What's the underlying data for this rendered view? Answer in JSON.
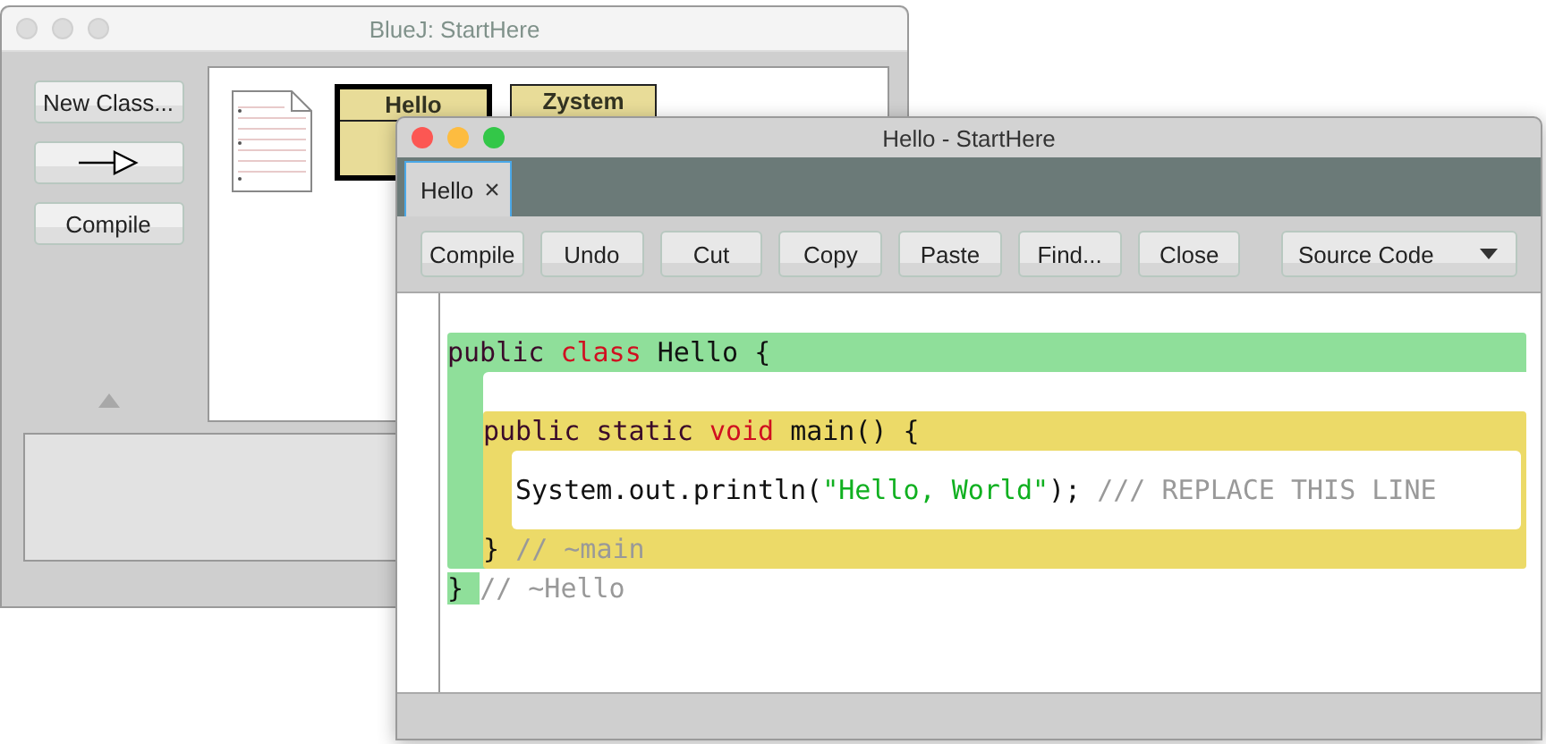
{
  "back_window": {
    "title": "BlueJ:  StartHere",
    "buttons": [
      {
        "label": "New Class...",
        "kind": "text"
      },
      {
        "kind": "arrow"
      },
      {
        "label": "Compile",
        "kind": "text"
      }
    ],
    "classes": [
      {
        "name": "Hello",
        "selected": true
      },
      {
        "name": "Zystem",
        "selected": false
      }
    ]
  },
  "front_window": {
    "title": "Hello - StartHere",
    "tabs": [
      {
        "label": "Hello",
        "close": "×",
        "selected": true
      }
    ],
    "toolbar": [
      "Compile",
      "Undo",
      "Cut",
      "Copy",
      "Paste",
      "Find...",
      "Close"
    ],
    "view_selector": "Source Code",
    "code": {
      "class_header": [
        {
          "text": "public ",
          "kind": "modifier"
        },
        {
          "text": "class ",
          "kind": "keyword"
        },
        {
          "text": "Hello {",
          "kind": "plain"
        }
      ],
      "method_header": [
        {
          "text": "public static ",
          "kind": "modifier"
        },
        {
          "text": "void ",
          "kind": "keyword"
        },
        {
          "text": "main() {",
          "kind": "plain"
        }
      ],
      "method_body": [
        [
          {
            "text": "System.out.println(",
            "kind": "plain"
          },
          {
            "text": "\"Hello, World\"",
            "kind": "string"
          },
          {
            "text": "); ",
            "kind": "plain"
          },
          {
            "text": "/// REPLACE THIS LINE",
            "kind": "comment"
          }
        ]
      ],
      "method_footer": [
        {
          "text": "} ",
          "kind": "plain"
        },
        {
          "text": "// ~main",
          "kind": "comment"
        }
      ],
      "class_footer": [
        {
          "text": "} ",
          "kind": "plain"
        },
        {
          "text": "// ~Hello",
          "kind": "comment"
        }
      ]
    }
  }
}
